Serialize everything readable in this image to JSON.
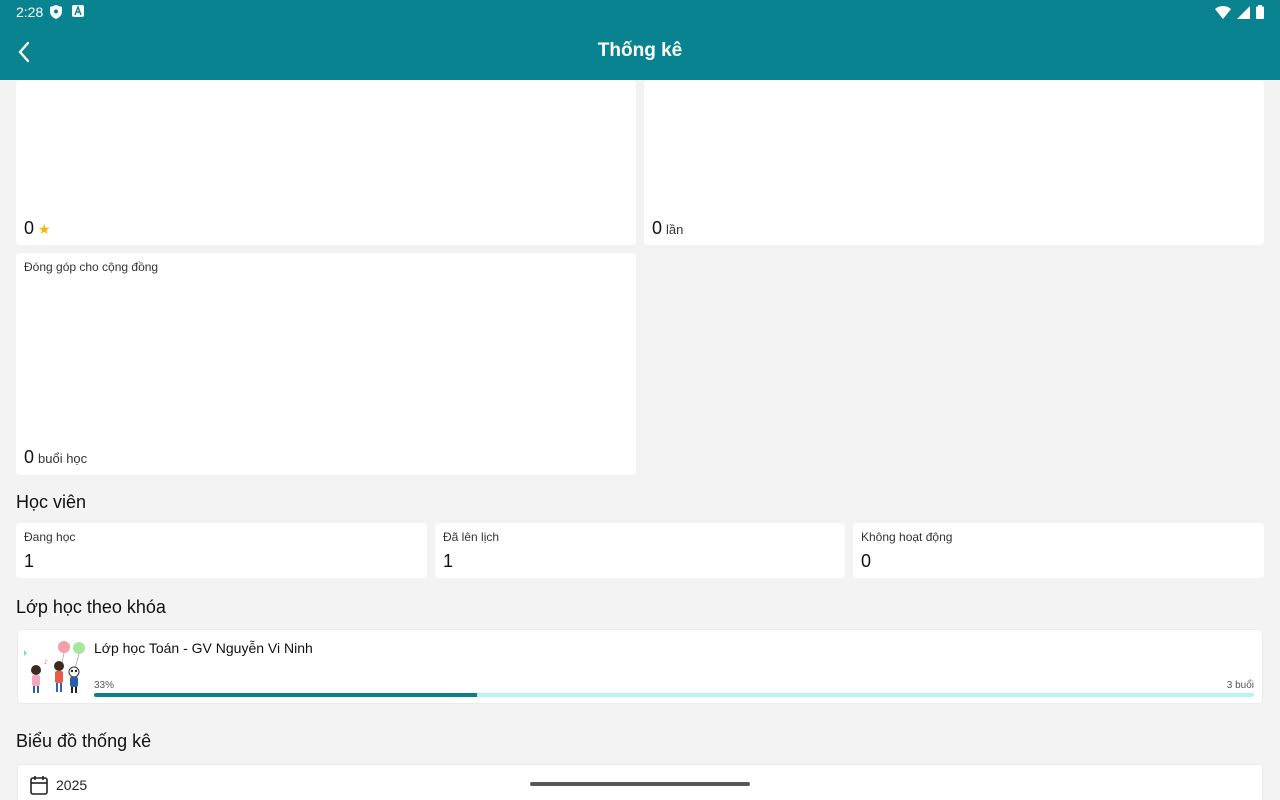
{
  "status_bar": {
    "time": "2:28"
  },
  "app_bar": {
    "title": "Thống kê"
  },
  "top_cards": {
    "rating": {
      "value": "0"
    },
    "count": {
      "value": "0",
      "unit": "lần"
    },
    "community": {
      "label": "Đóng góp cho cộng đồng",
      "value": "0",
      "unit": "buổi học"
    }
  },
  "students": {
    "title": "Học viên",
    "items": [
      {
        "label": "Đang học",
        "value": "1"
      },
      {
        "label": "Đã lên lịch",
        "value": "1"
      },
      {
        "label": "Không hoạt động",
        "value": "0"
      }
    ]
  },
  "courses": {
    "title": "Lớp học theo khóa",
    "items": [
      {
        "title": "Lớp học Toán - GV Nguyễn Vi Ninh",
        "progress_label": "33%",
        "progress": 0.33,
        "total": "3 buổi"
      }
    ]
  },
  "chart": {
    "title": "Biểu đồ thống kê",
    "year": "2025"
  },
  "colors": {
    "primary": "#08838f",
    "progress_fill": "#0b7f8c",
    "progress_track": "#b8f3f6",
    "star": "#f5b50a"
  }
}
